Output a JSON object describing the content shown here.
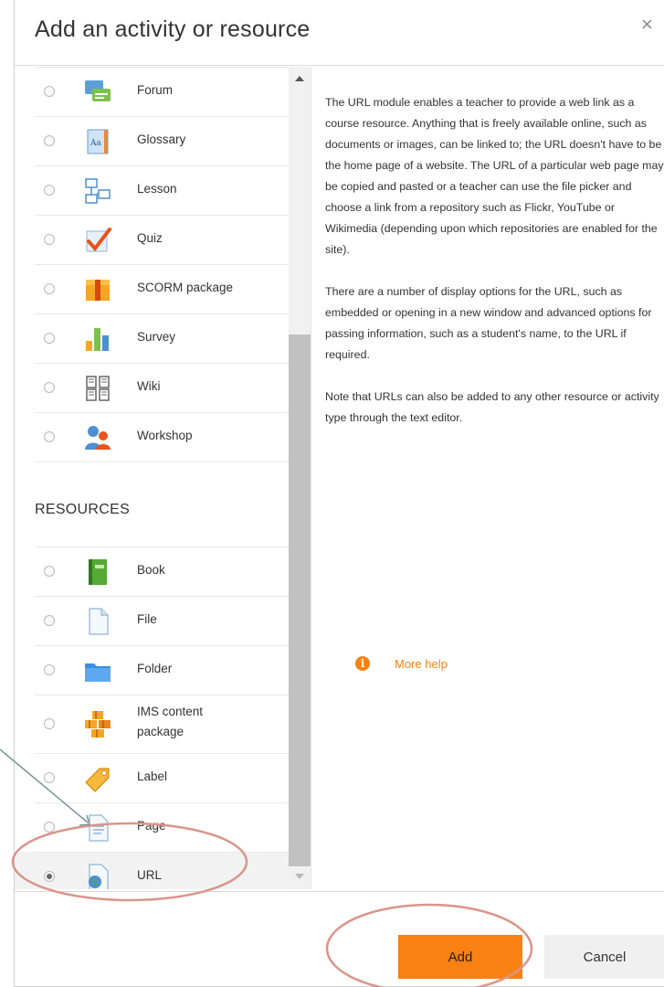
{
  "dialog": {
    "title": "Add an activity or resource",
    "close_glyph": "×"
  },
  "activities": [
    {
      "label": "Forum",
      "icon": "forum-icon"
    },
    {
      "label": "Glossary",
      "icon": "glossary-icon"
    },
    {
      "label": "Lesson",
      "icon": "lesson-icon"
    },
    {
      "label": "Quiz",
      "icon": "quiz-icon"
    },
    {
      "label": "SCORM package",
      "icon": "scorm-package-icon"
    },
    {
      "label": "Survey",
      "icon": "survey-icon"
    },
    {
      "label": "Wiki",
      "icon": "wiki-icon"
    },
    {
      "label": "Workshop",
      "icon": "workshop-icon"
    }
  ],
  "resources_header": "RESOURCES",
  "resources": [
    {
      "label": "Book",
      "icon": "book-icon"
    },
    {
      "label": "File",
      "icon": "file-icon"
    },
    {
      "label": "Folder",
      "icon": "folder-icon"
    },
    {
      "label": "IMS content package",
      "icon": "ims-package-icon"
    },
    {
      "label": "Label",
      "icon": "label-icon"
    },
    {
      "label": "Page",
      "icon": "page-icon"
    },
    {
      "label": "URL",
      "icon": "url-icon",
      "selected": true
    }
  ],
  "description": {
    "p1": "The URL module enables a teacher to provide a web link as a course resource. Anything that is freely available online, such as documents or images, can be linked to; the URL doesn't have to be the home page of a website. The URL of a particular web page may be copied and pasted or a teacher can use the file picker and choose a link from a repository such as Flickr, YouTube or Wikimedia (depending upon which repositories are enabled for the site).",
    "p2": "There are a number of display options for the URL, such as embedded or opening in a new window and advanced options for passing information, such as a student's name, to the URL if required.",
    "p3": "Note that URLs can also be added to any other resource or activity type through the text editor.",
    "help_label": "More help",
    "help_icon": "info-icon"
  },
  "footer": {
    "add_label": "Add",
    "cancel_label": "Cancel"
  },
  "colors": {
    "accent": "#f98012",
    "annotation": "#d9958b",
    "arrow": "#7d9597"
  }
}
